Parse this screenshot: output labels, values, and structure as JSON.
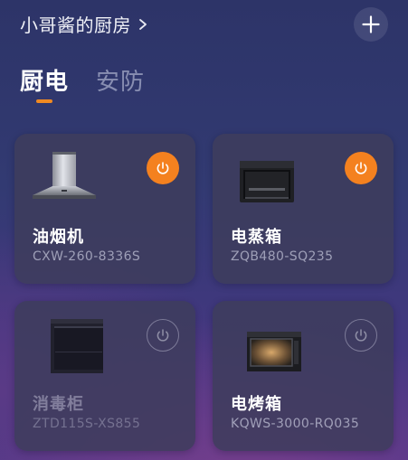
{
  "header": {
    "title": "小哥酱的厨房",
    "chevron_icon": "chevron-right-icon",
    "add_icon": "plus-icon"
  },
  "tabs": [
    {
      "label": "厨电",
      "active": true
    },
    {
      "label": "安防",
      "active": false
    }
  ],
  "colors": {
    "accent": "#f4811f",
    "card_bg": "#3e3c5c",
    "power_off_ring": "#8f8fa6"
  },
  "devices": [
    {
      "name": "油烟机",
      "model": "CXW-260-8336S",
      "power": "on",
      "online": true,
      "icon": "range-hood-icon"
    },
    {
      "name": "电蒸箱",
      "model": "ZQB480-SQ235",
      "power": "on",
      "online": true,
      "icon": "steam-oven-icon"
    },
    {
      "name": "消毒柜",
      "model": "ZTD115S-XS855",
      "power": "off",
      "online": false,
      "icon": "disinfection-cabinet-icon"
    },
    {
      "name": "电烤箱",
      "model": "KQWS-3000-RQ035",
      "power": "off",
      "online": true,
      "icon": "electric-oven-icon"
    }
  ]
}
